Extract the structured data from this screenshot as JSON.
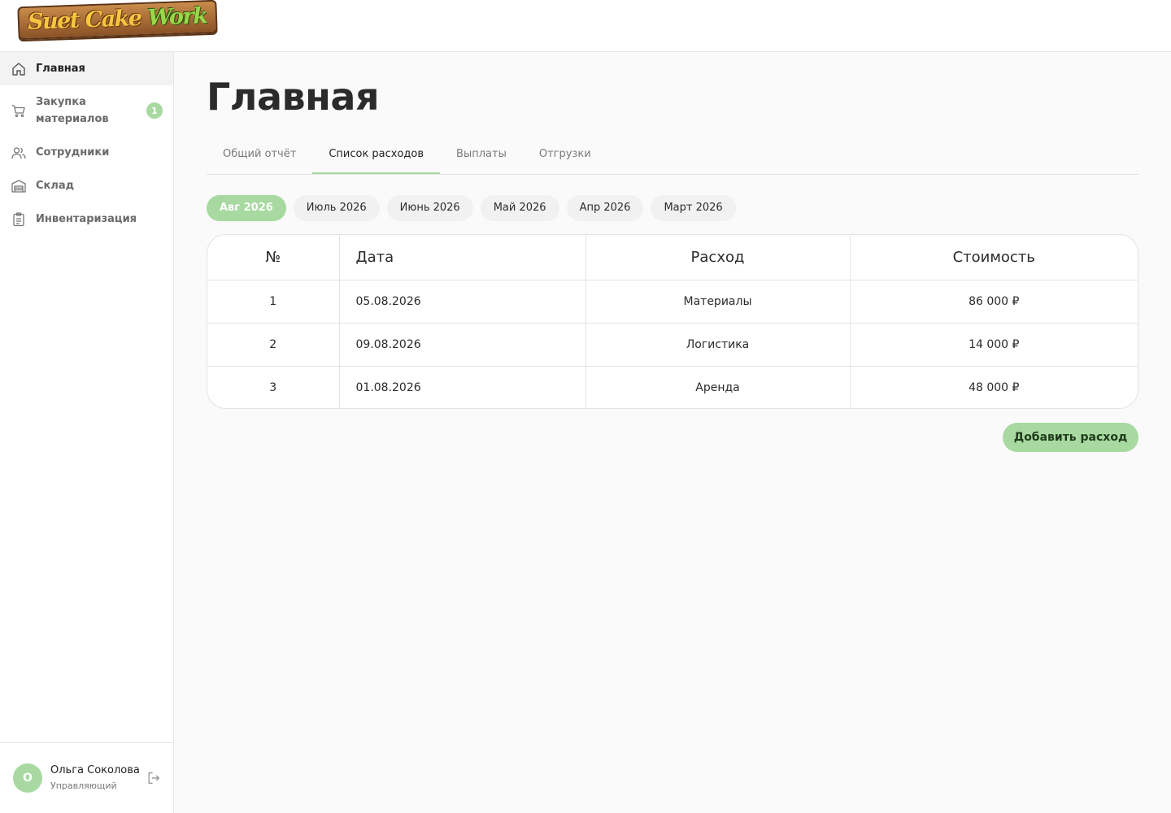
{
  "brand": {
    "name_part1": "Suet Cake ",
    "name_part2": "Work"
  },
  "sidebar": {
    "items": [
      {
        "label": "Главная",
        "icon": "home-icon",
        "active": true
      },
      {
        "label": "Закупка материалов",
        "icon": "cart-icon",
        "badge": "1"
      },
      {
        "label": "Сотрудники",
        "icon": "users-icon"
      },
      {
        "label": "Склад",
        "icon": "warehouse-icon"
      },
      {
        "label": "Инвентаризация",
        "icon": "clipboard-icon"
      }
    ]
  },
  "user": {
    "initial": "О",
    "name": "Ольга Соколова",
    "role": "Управляющий"
  },
  "page": {
    "title": "Главная"
  },
  "tabs": [
    {
      "label": "Общий отчёт"
    },
    {
      "label": "Список расходов",
      "active": true
    },
    {
      "label": "Выплаты"
    },
    {
      "label": "Отгрузки"
    }
  ],
  "months": [
    {
      "label": "Авг 2026",
      "active": true
    },
    {
      "label": "Июль 2026"
    },
    {
      "label": "Июнь 2026"
    },
    {
      "label": "Май 2026"
    },
    {
      "label": "Апр 2026"
    },
    {
      "label": "Март 2026"
    }
  ],
  "table": {
    "headers": {
      "num": "№",
      "date": "Дата",
      "expense": "Расход",
      "cost": "Стоимость"
    },
    "rows": [
      {
        "num": "1",
        "date": "05.08.2026",
        "expense": "Материалы",
        "cost": "86 000 ₽"
      },
      {
        "num": "2",
        "date": "09.08.2026",
        "expense": "Логистика",
        "cost": "14 000 ₽"
      },
      {
        "num": "3",
        "date": "01.08.2026",
        "expense": "Аренда",
        "cost": "48 000 ₽"
      }
    ]
  },
  "actions": {
    "add_expense": "Добавить расход"
  },
  "colors": {
    "accent": "#a7d9a0",
    "text": "#2b2b2b",
    "muted": "#7a7a7a",
    "background": "#fafafa",
    "border": "#e3e3e3"
  }
}
